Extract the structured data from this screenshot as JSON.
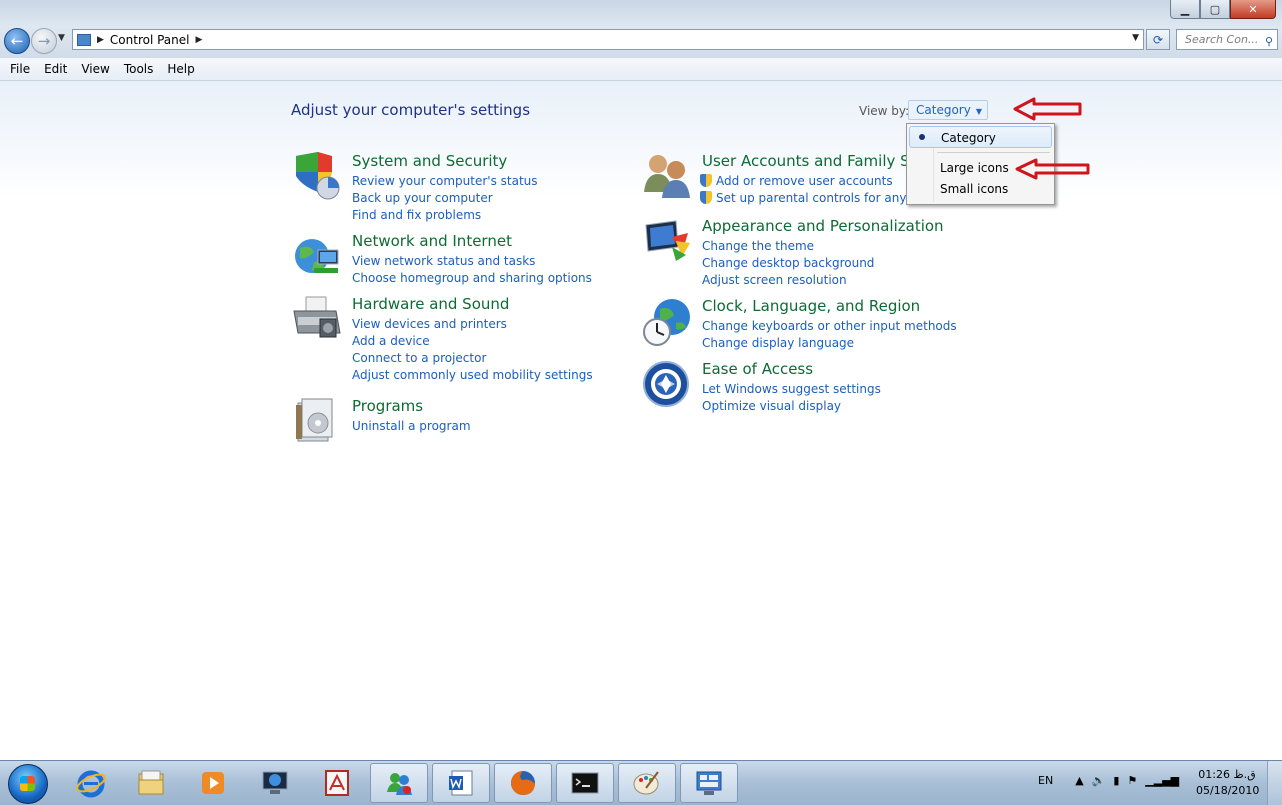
{
  "window": {
    "controls": {
      "minimize": "▁",
      "maximize": "▢",
      "close": "✕"
    }
  },
  "navigation": {
    "back_icon": "arrow-left-icon",
    "forward_icon": "arrow-right-icon",
    "breadcrumb": [
      "Control Panel"
    ],
    "search_placeholder": "Search Con..."
  },
  "menu": [
    "File",
    "Edit",
    "View",
    "Tools",
    "Help"
  ],
  "main": {
    "title": "Adjust your computer's settings",
    "view_by": {
      "label": "View by:",
      "value": "Category"
    },
    "dropdown": {
      "options": [
        "Category",
        "Large icons",
        "Small icons"
      ],
      "selected": "Category"
    },
    "categories_left": [
      {
        "title": "System and Security",
        "icon": "shield-icon",
        "links": [
          "Review your computer's status",
          "Back up your computer",
          "Find and fix problems"
        ]
      },
      {
        "title": "Network and Internet",
        "icon": "globe-network-icon",
        "links": [
          "View network status and tasks",
          "Choose homegroup and sharing options"
        ]
      },
      {
        "title": "Hardware and Sound",
        "icon": "printer-icon",
        "links": [
          "View devices and printers",
          "Add a device",
          "Connect to a projector",
          "Adjust commonly used mobility settings"
        ]
      },
      {
        "title": "Programs",
        "icon": "programs-icon",
        "links": [
          "Uninstall a program"
        ]
      }
    ],
    "categories_right": [
      {
        "title": "User Accounts and Family Saf",
        "icon": "users-icon",
        "links": [
          "Add or remove user accounts",
          "Set up parental controls for any use"
        ]
      },
      {
        "title": "Appearance and Personalization",
        "icon": "monitor-paint-icon",
        "links": [
          "Change the theme",
          "Change desktop background",
          "Adjust screen resolution"
        ]
      },
      {
        "title": "Clock, Language, and Region",
        "icon": "clock-globe-icon",
        "links": [
          "Change keyboards or other input methods",
          "Change display language"
        ]
      },
      {
        "title": "Ease of Access",
        "icon": "ease-of-access-icon",
        "links": [
          "Let Windows suggest settings",
          "Optimize visual display"
        ]
      }
    ]
  },
  "taskbar": {
    "tray": {
      "language": "EN"
    },
    "clock": {
      "time": "01:26 ق.ظ",
      "date": "05/18/2010"
    }
  },
  "colors": {
    "title_blue": "#1e3287",
    "category_green": "#0d6b33",
    "link_blue": "#1a5fbd",
    "annotation_red": "#d0141b"
  }
}
